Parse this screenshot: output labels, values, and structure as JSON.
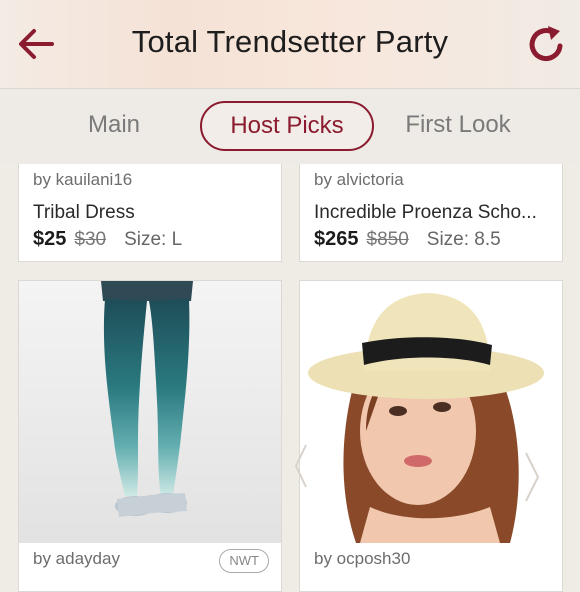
{
  "header": {
    "title": "Total Trendsetter Party",
    "back_icon": "arrow-left-icon",
    "refresh_icon": "refresh-icon",
    "accent_color": "#8b1b2f"
  },
  "tabs": [
    {
      "label": "Main",
      "active": false
    },
    {
      "label": "Host Picks",
      "active": true
    },
    {
      "label": "First Look",
      "active": false
    }
  ],
  "listings": [
    {
      "seller": "by kauilani16",
      "title": "Tribal Dress",
      "price": "$25",
      "original_price": "$30",
      "size": "Size: L"
    },
    {
      "seller": "by alvictoria",
      "title": "Incredible Proenza Scho...",
      "price": "$265",
      "original_price": "$850",
      "size": "Size: 8.5"
    },
    {
      "seller": "by adayday",
      "badge": "NWT",
      "image": "teal-ombre-tights-photo"
    },
    {
      "seller": "by ocposh30",
      "image": "straw-fedora-hat-photo"
    }
  ]
}
